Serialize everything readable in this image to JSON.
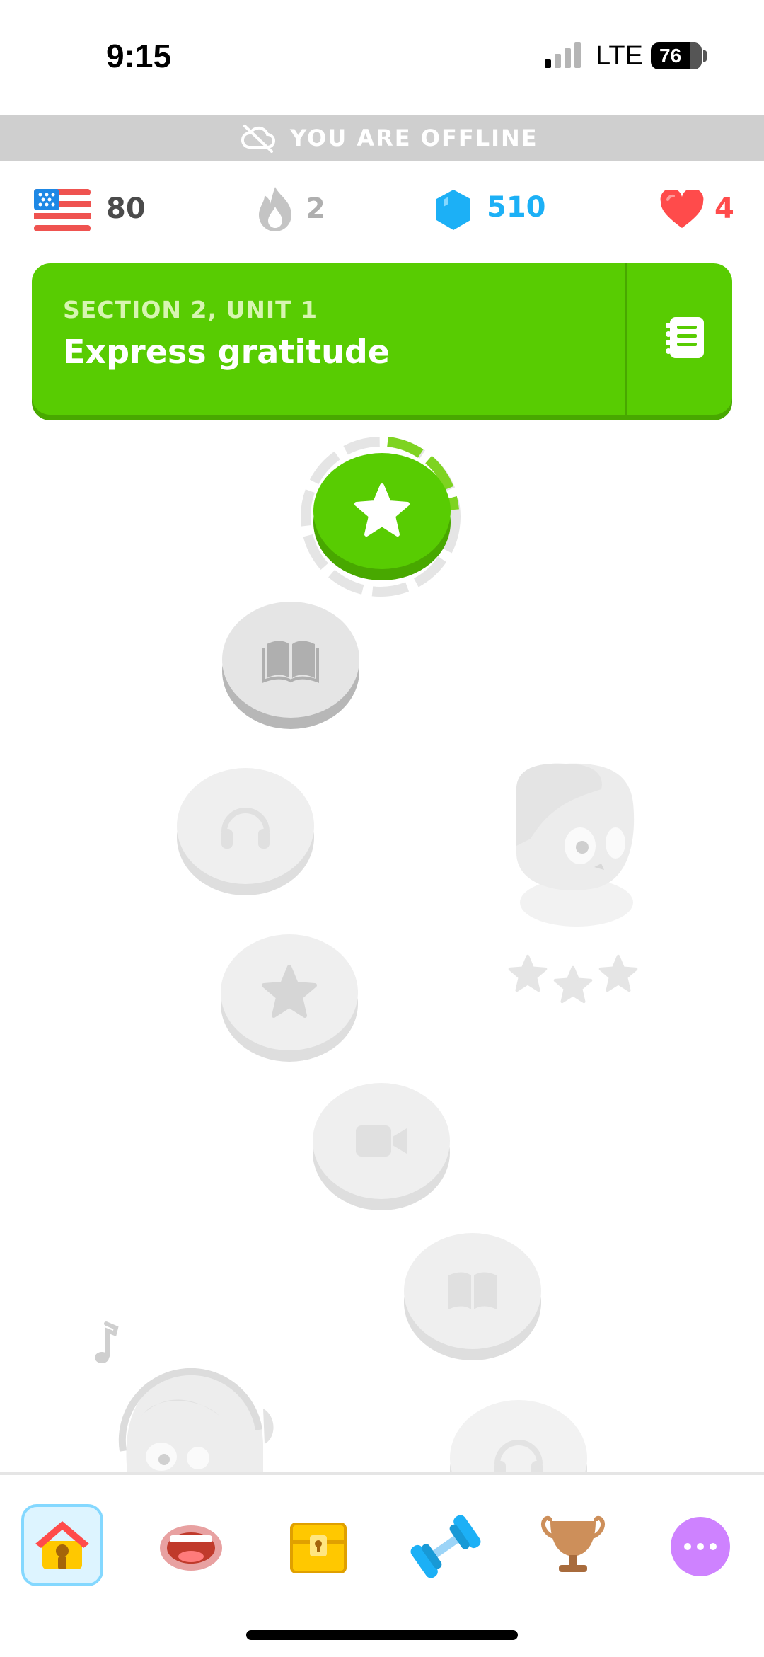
{
  "status_bar": {
    "time": "9:15",
    "network": "LTE",
    "battery": "76"
  },
  "offline_banner": {
    "text": "YOU ARE OFFLINE",
    "icon": "cloud-off-icon"
  },
  "stats": {
    "language_flag": "us-flag-icon",
    "language_xp": "80",
    "streak": "2",
    "gems": "510",
    "hearts": "4"
  },
  "unit": {
    "section": "SECTION 2, UNIT 1",
    "title": "Express gratitude",
    "guide_icon": "notebook-icon",
    "color": "#58cc02"
  },
  "path": {
    "nodes": [
      {
        "type": "star",
        "state": "active"
      },
      {
        "type": "book",
        "state": "locked"
      },
      {
        "type": "headphones",
        "state": "locked"
      },
      {
        "type": "star",
        "state": "locked"
      },
      {
        "type": "video",
        "state": "locked"
      },
      {
        "type": "book",
        "state": "locked"
      },
      {
        "type": "headphones",
        "state": "locked"
      }
    ],
    "character_stars": 3
  },
  "bottom_nav": {
    "items": [
      {
        "name": "home",
        "icon": "house-icon",
        "selected": true
      },
      {
        "name": "speak",
        "icon": "mouth-icon",
        "selected": false
      },
      {
        "name": "chest",
        "icon": "treasure-chest-icon",
        "selected": false
      },
      {
        "name": "practice",
        "icon": "dumbbell-icon",
        "selected": false
      },
      {
        "name": "leaderboard",
        "icon": "trophy-icon",
        "selected": false
      },
      {
        "name": "more",
        "icon": "more-dots-icon",
        "selected": false
      }
    ]
  },
  "colors": {
    "green": "#58cc02",
    "blue": "#1cb0f6",
    "red": "#ff4b4b",
    "gray": "#e5e5e5"
  }
}
